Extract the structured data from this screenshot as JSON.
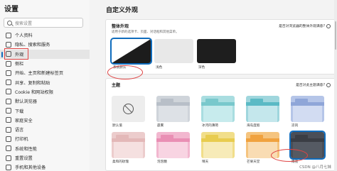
{
  "sidebar": {
    "title": "设置",
    "search_placeholder": "搜索设置",
    "items": [
      {
        "label": "个人资料",
        "icon": "person-icon"
      },
      {
        "label": "隐私、搜索和服务",
        "icon": "lock-icon"
      },
      {
        "label": "外观",
        "icon": "appearance-icon"
      },
      {
        "label": "侧栏",
        "icon": "sidebar-icon"
      },
      {
        "label": "开始、主页和新建标签页",
        "icon": "home-icon"
      },
      {
        "label": "共享、复制和粘贴",
        "icon": "share-icon"
      },
      {
        "label": "Cookie 和网站权限",
        "icon": "cookie-icon"
      },
      {
        "label": "默认浏览器",
        "icon": "browser-icon"
      },
      {
        "label": "下载",
        "icon": "download-icon"
      },
      {
        "label": "家庭安全",
        "icon": "family-icon"
      },
      {
        "label": "语言",
        "icon": "language-icon"
      },
      {
        "label": "打印机",
        "icon": "printer-icon"
      },
      {
        "label": "系统和性能",
        "icon": "system-icon"
      },
      {
        "label": "重置设置",
        "icon": "reset-icon"
      },
      {
        "label": "手机和其他设备",
        "icon": "phone-icon"
      }
    ]
  },
  "main": {
    "title": "自定义外观",
    "overall": {
      "title": "整体外观",
      "subtitle": "适用于新的选项卡、页面、对话框和其他菜单。",
      "link": "是否对浏览器的整体外观满意?",
      "options": [
        {
          "name": "系统默认",
          "selected": true
        },
        {
          "name": "浅色",
          "selected": false
        },
        {
          "name": "深色",
          "selected": false
        }
      ]
    },
    "themes": {
      "title": "主题",
      "link": "是否对此主题满意?",
      "items": [
        {
          "name": "默认值",
          "tab": "#e9e9e9",
          "bar": "#f3f3f3",
          "body": "#e6e6e6",
          "selected": false
        },
        {
          "name": "晨雾",
          "tab": "#b8bfc8",
          "bar": "#cfd4da",
          "body": "#dde1e6",
          "selected": false
        },
        {
          "name": "冰河的薄荷",
          "tab": "#79c8cc",
          "bar": "#a9dde0",
          "body": "#c7ebed",
          "selected": false
        },
        {
          "name": "海岛度假",
          "tab": "#5bbac5",
          "bar": "#9fd6dd",
          "body": "#c4e7ec",
          "selected": false
        },
        {
          "name": "凉风",
          "tab": "#8fa6d8",
          "bar": "#b5c5e8",
          "body": "#d2dcf2",
          "selected": false
        },
        {
          "name": "柔和的玫瑰",
          "tab": "#e3b8b8",
          "bar": "#eccccc",
          "body": "#f5e0e0",
          "selected": false
        },
        {
          "name": "泡泡糖",
          "tab": "#e98fb4",
          "bar": "#f2b7cf",
          "body": "#f8d4e2",
          "selected": false
        },
        {
          "name": "晴天",
          "tab": "#e8cc4f",
          "bar": "#f1de8a",
          "body": "#f7ebb8",
          "selected": false
        },
        {
          "name": "芒果天堂",
          "tab": "#f0a23f",
          "bar": "#f5c47f",
          "body": "#f9dcb3",
          "selected": false
        },
        {
          "name": "雨夜",
          "tab": "#3a3d44",
          "bar": "#4a4e57",
          "body": "#555a63",
          "selected": true
        }
      ]
    }
  },
  "watermark": "CSDN @八月七妹",
  "colors": {
    "accent": "#0f6cbd",
    "annotation": "#e04444"
  }
}
